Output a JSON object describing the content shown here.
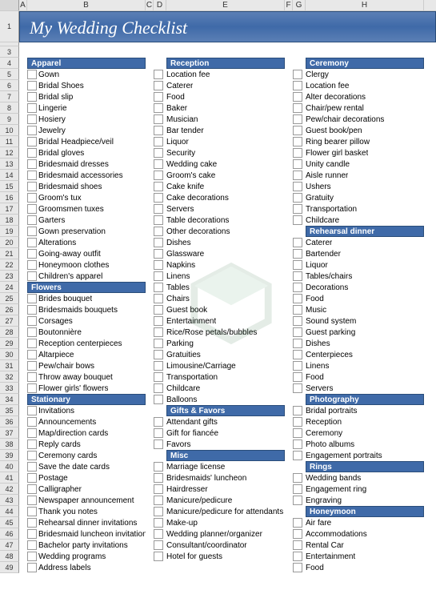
{
  "columns": [
    "A",
    "B",
    "C",
    "D",
    "E",
    "F",
    "G",
    "H"
  ],
  "title": "My Wedding Checklist",
  "row_count": 49,
  "colors": {
    "header_blue": "#3f6aa8",
    "title_font": "italic"
  },
  "col_b": [
    {
      "type": "header",
      "text": "Apparel"
    },
    {
      "type": "item",
      "text": "Gown"
    },
    {
      "type": "item",
      "text": "Bridal Shoes"
    },
    {
      "type": "item",
      "text": "Bridal slip"
    },
    {
      "type": "item",
      "text": "Lingerie"
    },
    {
      "type": "item",
      "text": "Hosiery"
    },
    {
      "type": "item",
      "text": "Jewelry"
    },
    {
      "type": "item",
      "text": "Bridal Headpiece/veil"
    },
    {
      "type": "item",
      "text": "Bridal gloves"
    },
    {
      "type": "item",
      "text": "Bridesmaid dresses"
    },
    {
      "type": "item",
      "text": "Bridesmaid accessories"
    },
    {
      "type": "item",
      "text": "Bridesmaid shoes"
    },
    {
      "type": "item",
      "text": "Groom's tux"
    },
    {
      "type": "item",
      "text": "Groomsmen tuxes"
    },
    {
      "type": "item",
      "text": "Garters"
    },
    {
      "type": "item",
      "text": "Gown preservation"
    },
    {
      "type": "item",
      "text": "Alterations"
    },
    {
      "type": "item",
      "text": "Going-away outfit"
    },
    {
      "type": "item",
      "text": "Honeymoon clothes"
    },
    {
      "type": "item",
      "text": "Children's apparel"
    },
    {
      "type": "header",
      "text": "Flowers"
    },
    {
      "type": "item",
      "text": "Brides bouquet"
    },
    {
      "type": "item",
      "text": "Bridesmaids bouquets"
    },
    {
      "type": "item",
      "text": "Corsages"
    },
    {
      "type": "item",
      "text": "Boutonnière"
    },
    {
      "type": "item",
      "text": "Reception centerpieces"
    },
    {
      "type": "item",
      "text": "Altarpiece"
    },
    {
      "type": "item",
      "text": "Pew/chair bows"
    },
    {
      "type": "item",
      "text": "Throw away bouquet"
    },
    {
      "type": "item",
      "text": "Flower girls' flowers"
    },
    {
      "type": "header",
      "text": "Stationary"
    },
    {
      "type": "item",
      "text": "Invitations"
    },
    {
      "type": "item",
      "text": "Announcements"
    },
    {
      "type": "item",
      "text": "Map/direction cards"
    },
    {
      "type": "item",
      "text": "Reply cards"
    },
    {
      "type": "item",
      "text": "Ceremony cards"
    },
    {
      "type": "item",
      "text": "Save the date cards"
    },
    {
      "type": "item",
      "text": "Postage"
    },
    {
      "type": "item",
      "text": "Calligrapher"
    },
    {
      "type": "item",
      "text": "Newspaper announcement"
    },
    {
      "type": "item",
      "text": "Thank you notes"
    },
    {
      "type": "item",
      "text": "Rehearsal dinner invitations"
    },
    {
      "type": "item",
      "text": "Bridesmaid luncheon invitations"
    },
    {
      "type": "item",
      "text": "Bachelor party invitations"
    },
    {
      "type": "item",
      "text": "Wedding programs"
    },
    {
      "type": "item",
      "text": "Address labels"
    }
  ],
  "col_e": [
    {
      "type": "header",
      "text": "Reception"
    },
    {
      "type": "item",
      "text": "Location fee"
    },
    {
      "type": "item",
      "text": "Caterer"
    },
    {
      "type": "item",
      "text": "Food"
    },
    {
      "type": "item",
      "text": "Baker"
    },
    {
      "type": "item",
      "text": "Musician"
    },
    {
      "type": "item",
      "text": "Bar tender"
    },
    {
      "type": "item",
      "text": "Liquor"
    },
    {
      "type": "item",
      "text": "Security"
    },
    {
      "type": "item",
      "text": "Wedding cake"
    },
    {
      "type": "item",
      "text": "Groom's cake"
    },
    {
      "type": "item",
      "text": "Cake knife"
    },
    {
      "type": "item",
      "text": "Cake decorations"
    },
    {
      "type": "item",
      "text": "Servers"
    },
    {
      "type": "item",
      "text": "Table decorations"
    },
    {
      "type": "item",
      "text": "Other decorations"
    },
    {
      "type": "item",
      "text": "Dishes"
    },
    {
      "type": "item",
      "text": "Glassware"
    },
    {
      "type": "item",
      "text": "Napkins"
    },
    {
      "type": "item",
      "text": "Linens"
    },
    {
      "type": "item",
      "text": "Tables"
    },
    {
      "type": "item",
      "text": "Chairs"
    },
    {
      "type": "item",
      "text": "Guest book"
    },
    {
      "type": "item",
      "text": "Entertainment"
    },
    {
      "type": "item",
      "text": "Rice/Rose petals/bubbles"
    },
    {
      "type": "item",
      "text": "Parking"
    },
    {
      "type": "item",
      "text": "Gratuities"
    },
    {
      "type": "item",
      "text": "Limousine/Carriage"
    },
    {
      "type": "item",
      "text": "Transportation"
    },
    {
      "type": "item",
      "text": "Childcare"
    },
    {
      "type": "item",
      "text": "Balloons"
    },
    {
      "type": "header",
      "text": "Gifts & Favors"
    },
    {
      "type": "item",
      "text": "Attendant gifts"
    },
    {
      "type": "item",
      "text": "Gift for fiancée"
    },
    {
      "type": "item",
      "text": "Favors"
    },
    {
      "type": "header",
      "text": "Misc"
    },
    {
      "type": "item",
      "text": "Marriage license"
    },
    {
      "type": "item",
      "text": "Bridesmaids' luncheon"
    },
    {
      "type": "item",
      "text": "Hairdresser"
    },
    {
      "type": "item",
      "text": "Manicure/pedicure"
    },
    {
      "type": "item",
      "text": "Manicure/pedicure for attendants"
    },
    {
      "type": "item",
      "text": "Make-up"
    },
    {
      "type": "item",
      "text": "Wedding planner/organizer"
    },
    {
      "type": "item",
      "text": "Consultant/coordinator"
    },
    {
      "type": "item",
      "text": "Hotel for guests"
    },
    {
      "type": "blank",
      "text": ""
    }
  ],
  "col_h": [
    {
      "type": "header",
      "text": "Ceremony"
    },
    {
      "type": "item",
      "text": "Clergy"
    },
    {
      "type": "item",
      "text": "Location fee"
    },
    {
      "type": "item",
      "text": "Alter decorations"
    },
    {
      "type": "item",
      "text": "Chair/pew rental"
    },
    {
      "type": "item",
      "text": "Pew/chair decorations"
    },
    {
      "type": "item",
      "text": "Guest book/pen"
    },
    {
      "type": "item",
      "text": "Ring bearer pillow"
    },
    {
      "type": "item",
      "text": "Flower girl basket"
    },
    {
      "type": "item",
      "text": "Unity candle"
    },
    {
      "type": "item",
      "text": "Aisle runner"
    },
    {
      "type": "item",
      "text": "Ushers"
    },
    {
      "type": "item",
      "text": "Gratuity"
    },
    {
      "type": "item",
      "text": "Transportation"
    },
    {
      "type": "item",
      "text": "Childcare"
    },
    {
      "type": "header",
      "text": "Rehearsal dinner"
    },
    {
      "type": "item",
      "text": "Caterer"
    },
    {
      "type": "item",
      "text": "Bartender"
    },
    {
      "type": "item",
      "text": "Liquor"
    },
    {
      "type": "item",
      "text": "Tables/chairs"
    },
    {
      "type": "item",
      "text": "Decorations"
    },
    {
      "type": "item",
      "text": "Food"
    },
    {
      "type": "item",
      "text": "Music"
    },
    {
      "type": "item",
      "text": "Sound system"
    },
    {
      "type": "item",
      "text": "Guest parking"
    },
    {
      "type": "item",
      "text": "Dishes"
    },
    {
      "type": "item",
      "text": "Centerpieces"
    },
    {
      "type": "item",
      "text": "Linens"
    },
    {
      "type": "item",
      "text": "Food"
    },
    {
      "type": "item",
      "text": "Servers"
    },
    {
      "type": "header",
      "text": "Photography"
    },
    {
      "type": "item",
      "text": "Bridal portraits"
    },
    {
      "type": "item",
      "text": "Reception"
    },
    {
      "type": "item",
      "text": "Ceremony"
    },
    {
      "type": "item",
      "text": "Photo albums"
    },
    {
      "type": "item",
      "text": "Engagement portraits"
    },
    {
      "type": "header",
      "text": "Rings"
    },
    {
      "type": "item",
      "text": "Wedding bands"
    },
    {
      "type": "item",
      "text": "Engagement ring"
    },
    {
      "type": "item",
      "text": "Engraving"
    },
    {
      "type": "header",
      "text": "Honeymoon"
    },
    {
      "type": "item",
      "text": "Air fare"
    },
    {
      "type": "item",
      "text": "Accommodations"
    },
    {
      "type": "item",
      "text": "Rental Car"
    },
    {
      "type": "item",
      "text": "Entertainment"
    },
    {
      "type": "item",
      "text": "Food"
    }
  ]
}
